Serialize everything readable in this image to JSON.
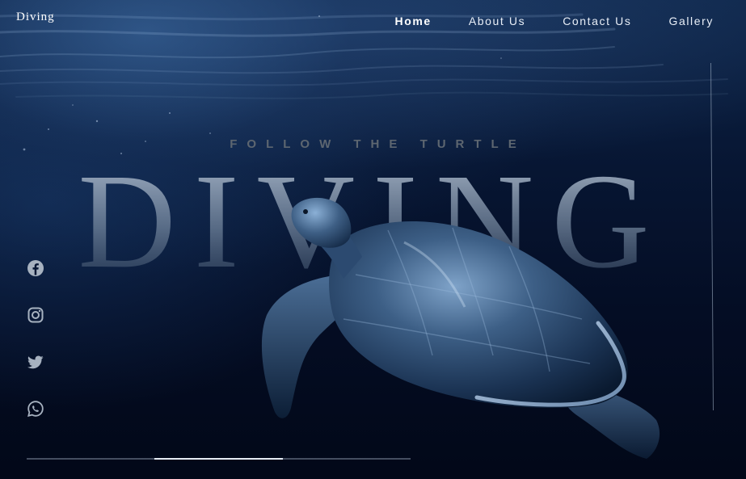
{
  "brand": {
    "logo_text": "Diving"
  },
  "nav": {
    "items": [
      {
        "label": "Home",
        "active": true
      },
      {
        "label": "About Us",
        "active": false
      },
      {
        "label": "Contact Us",
        "active": false
      },
      {
        "label": "Gallery",
        "active": false
      }
    ]
  },
  "hero": {
    "tagline": "FOLLOW THE TURTLE",
    "title": "DIVING"
  },
  "social": {
    "icons": [
      "facebook-icon",
      "instagram-icon",
      "twitter-icon",
      "whatsapp-icon"
    ]
  },
  "slider": {
    "slide_count": 3,
    "active_slide": 2
  },
  "colors": {
    "background": "#02081a",
    "accent": "#e6ecf4",
    "tagline": "#5d6670"
  }
}
